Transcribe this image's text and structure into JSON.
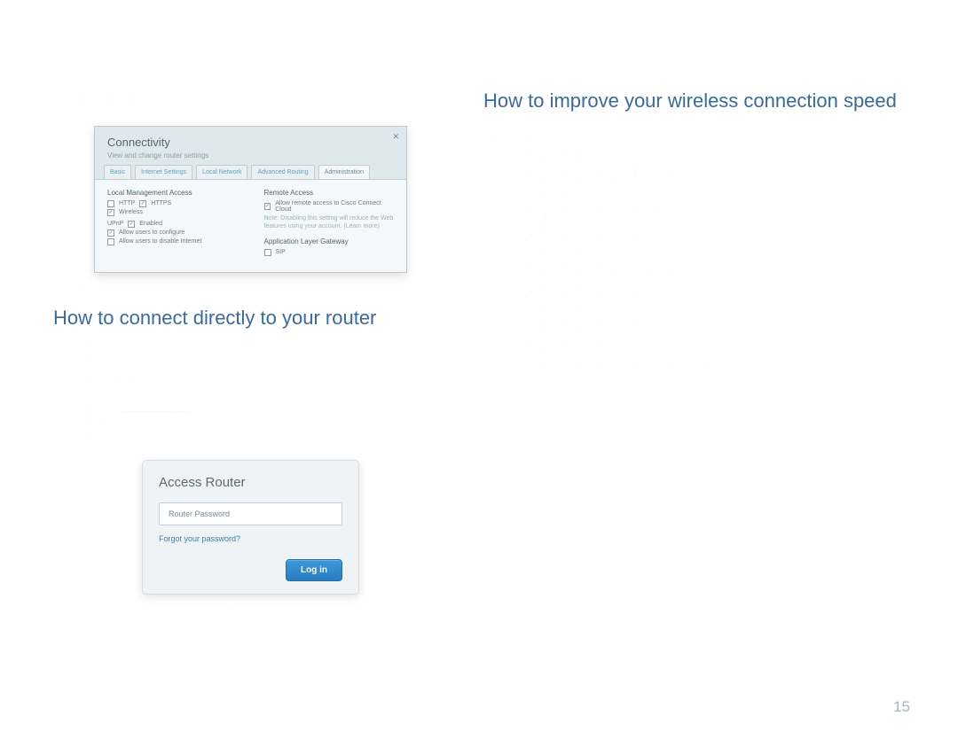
{
  "page_number": "15",
  "left": {
    "heading": "How to connect directly to your router"
  },
  "right": {
    "heading": "How to improve your wireless connection speed"
  },
  "screenshot_connectivity": {
    "title": "Connectivity",
    "subtitle": "View and change router settings",
    "tabs": [
      "Basic",
      "Internet Settings",
      "Local Network",
      "Advanced Routing",
      "Administration"
    ],
    "left_col": {
      "header": "Local Management Access",
      "http": "HTTP",
      "https": "HTTPS",
      "wireless": "Wireless",
      "upnp_label": "UPnP",
      "upnp_value": "Enabled",
      "upnp_opt1": "Allow users to configure",
      "upnp_opt2": "Allow users to disable Internet"
    },
    "right_col": {
      "header": "Remote Access",
      "remote_label": "Allow remote access to Cisco Connect Cloud",
      "remote_note": "Note: Disabling this setting will reduce the Web features using your account. (Learn more)",
      "alg_header": "Application Layer Gateway",
      "alg_sip": "SIP"
    }
  },
  "access_router": {
    "title": "Access Router",
    "placeholder": "Router Password",
    "forgot": "Forgot your password?",
    "login": "Log in"
  }
}
